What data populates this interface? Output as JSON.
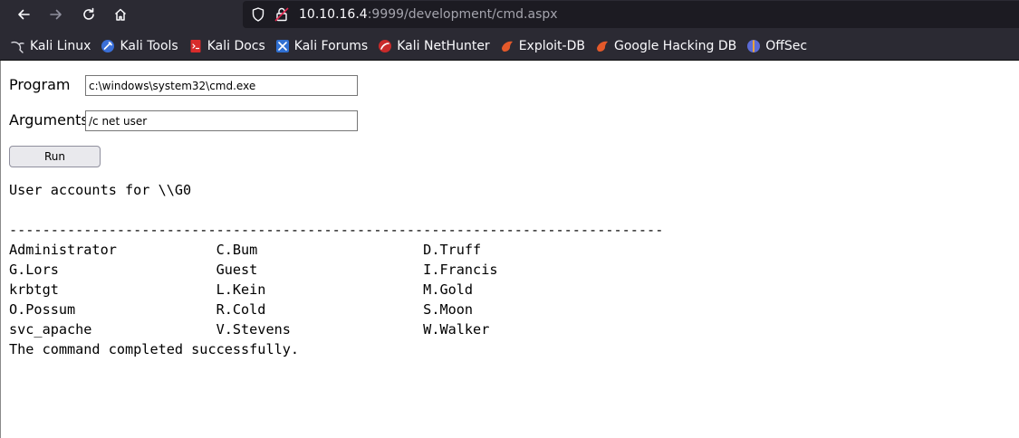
{
  "browser": {
    "url_host": "10.10.16.4",
    "url_rest": ":9999/development/cmd.aspx",
    "icons": {
      "back": "back-arrow-icon",
      "forward": "forward-arrow-icon",
      "reload": "reload-icon",
      "home": "home-icon",
      "shield": "shield-icon",
      "lock": "lock-icon"
    },
    "bookmarks": [
      {
        "label": "Kali Linux",
        "icon": "kali-dragon-icon"
      },
      {
        "label": "Kali Tools",
        "icon": "kali-tools-icon"
      },
      {
        "label": "Kali Docs",
        "icon": "kali-docs-icon"
      },
      {
        "label": "Kali Forums",
        "icon": "kali-forums-icon"
      },
      {
        "label": "Kali NetHunter",
        "icon": "kali-nethunter-icon"
      },
      {
        "label": "Exploit-DB",
        "icon": "exploit-db-icon"
      },
      {
        "label": "Google Hacking DB",
        "icon": "ghdb-icon"
      },
      {
        "label": "OffSec",
        "icon": "offsec-icon"
      }
    ]
  },
  "form": {
    "program_label": "Program",
    "program_value": "c:\\windows\\system32\\cmd.exe",
    "arguments_label": "Arguments",
    "arguments_value": "/c net user",
    "run_label": "Run"
  },
  "output": {
    "lines": [
      "User accounts for \\\\G0",
      "",
      "-------------------------------------------------------------------------------",
      "Administrator            C.Bum                    D.Truff",
      "G.Lors                   Guest                    I.Francis",
      "krbtgt                   L.Kein                   M.Gold",
      "O.Possum                 R.Cold                   S.Moon",
      "svc_apache               V.Stevens                W.Walker",
      "The command completed successfully."
    ]
  }
}
